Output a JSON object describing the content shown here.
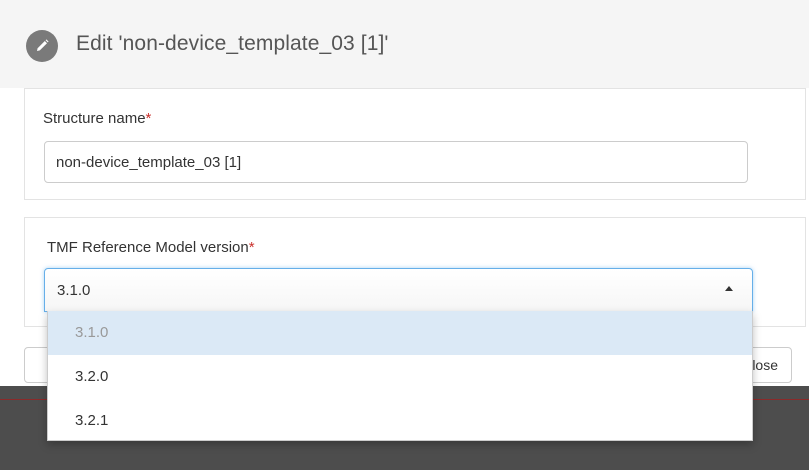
{
  "dialog": {
    "title": "Edit 'non-device_template_03 [1]'",
    "title_icon": "pencil-icon"
  },
  "structure_name": {
    "label": "Structure name",
    "required_marker": "*",
    "value": "non-device_template_03 [1]"
  },
  "tmf_version": {
    "label": "TMF Reference Model version",
    "required_marker": "*",
    "selected": "3.1.0",
    "arrow_icon": "caret-up-icon",
    "options": [
      {
        "label": "3.1.0",
        "selected": true
      },
      {
        "label": "3.2.0",
        "selected": false
      },
      {
        "label": "3.2.1",
        "selected": false
      }
    ]
  },
  "footer": {
    "close_label": "Close"
  },
  "colors": {
    "header_bg": "#f5f5f5",
    "required": "#c9302c",
    "focus_border": "#66afe9",
    "selected_option_bg": "#dbe9f6",
    "dark_band": "#4d4d4d"
  }
}
